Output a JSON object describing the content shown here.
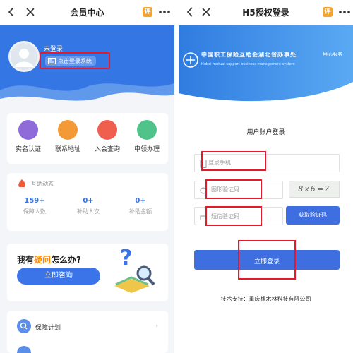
{
  "left": {
    "title": "会员中心",
    "mini_app_badge": "评",
    "login_status": "未登录",
    "login_button": "点击登录系统",
    "actions": [
      {
        "label": "实名认证",
        "color": "#8f6bd9"
      },
      {
        "label": "联系地址",
        "color": "#f39a36"
      },
      {
        "label": "入会查询",
        "color": "#f05f4e"
      },
      {
        "label": "申领办理",
        "color": "#4fc38a"
      }
    ],
    "stats_title": "互助动态",
    "stats": [
      {
        "value": "159+",
        "caption": "保障人数"
      },
      {
        "value": "0+",
        "caption": "补助人次"
      },
      {
        "value": "0+",
        "caption": "补助金额"
      }
    ],
    "ask": {
      "prefix": "我有",
      "highlight": "疑问",
      "suffix": "怎么办?",
      "button": "立即咨询"
    },
    "plan_label": "保障计划"
  },
  "right": {
    "title": "H5授权登录",
    "mini_app_badge": "评",
    "org_name_cn": "中国职工保险互助会湖北省办事处",
    "org_name_en": "Hubei mutual support business management system",
    "org_slogan": "用心服务",
    "form_title": "用户账户登录",
    "phone_placeholder": "登录手机",
    "image_code_placeholder": "图形验证码",
    "captcha_text": "8x6=?",
    "sms_code_placeholder": "短信验证码",
    "sms_button": "获取验证码",
    "submit_button": "立即登录",
    "support": "技术支持：重庆橡木林科技有限公司"
  },
  "colors": {
    "brand_blue": "#3476e4",
    "highlight_red": "#e5192a"
  }
}
